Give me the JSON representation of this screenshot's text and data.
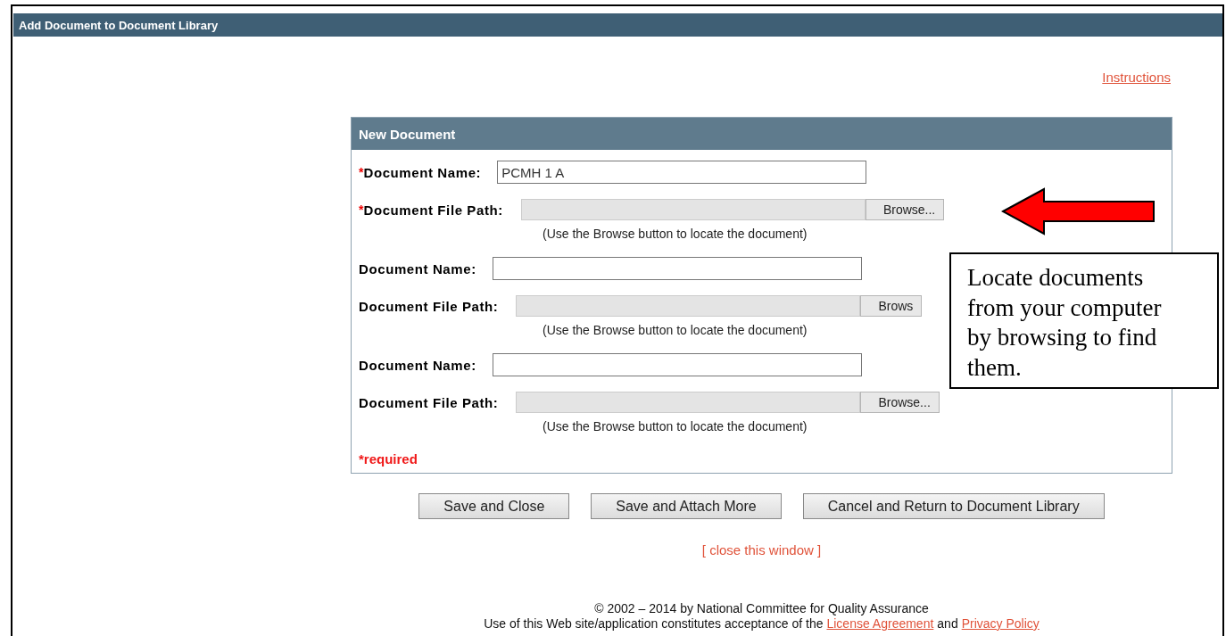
{
  "header": {
    "title": "Add Document to Document Library"
  },
  "instructions_link": "Instructions",
  "panel": {
    "title": "New Document",
    "groups": [
      {
        "required_mark": "*",
        "name_label": "Document Name:",
        "name_value": "PCMH 1 A",
        "path_label": "Document File Path:",
        "browse_label": "Browse...",
        "hint": "(Use the Browse button to locate the document)"
      },
      {
        "name_label": "Document Name:",
        "path_label": "Document File Path:",
        "browse_label": "Brows",
        "hint": "(Use the Browse button to locate the document)"
      },
      {
        "name_label": "Document Name:",
        "path_label": "Document File Path:",
        "browse_label": "Browse...",
        "hint": "(Use the Browse button to locate the document)"
      }
    ],
    "required_note": "*required"
  },
  "buttons": [
    "Save and Close",
    "Save and Attach More",
    "Cancel and Return to Document Library"
  ],
  "close_link": "[ close this window ]",
  "footer": {
    "copyright": "© 2002 – 2014 by National Committee for Quality Assurance",
    "terms": "Use of this Web site/application constitutes acceptance of the",
    "links": [
      "License Agreement",
      "Privacy Policy"
    ],
    "conjunction": "and"
  },
  "callout": {
    "text": "Locate documents from your computer by browsing to find them."
  }
}
